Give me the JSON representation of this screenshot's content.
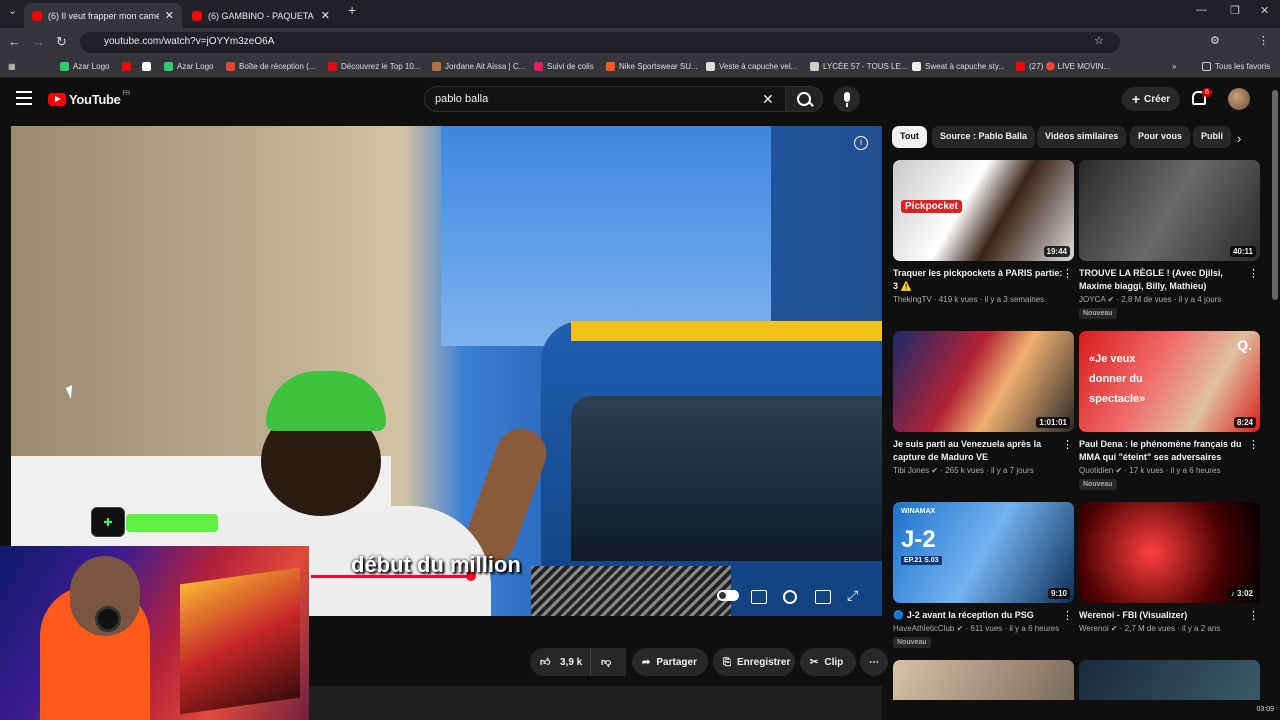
{
  "browser": {
    "tabs": [
      {
        "label": "(6) Il veut frapper mon caméra",
        "active": true
      },
      {
        "label": "(6) GAMBINO - PAQUETA (Clip",
        "active": false
      }
    ],
    "new_tab": "+",
    "url": "youtube.com/watch?v=jOYYm3zeO6A",
    "bookmarks": [
      "Azar Logo",
      "Azar Logo",
      "Boîte de réception (...",
      "Découvrez le Top 10...",
      "Jordane Ait Aissa | C...",
      "Suivi de colis",
      "Nike Sportswear SU...",
      "Veste à capuche vel...",
      "LYCÉE 57 - TOUS LE...",
      "Sweat à capuche sty...",
      "(27) 🔴 LIVE MOVIN..."
    ],
    "all_favorites": "Tous les favoris"
  },
  "youtube": {
    "logo": "YouTube",
    "region": "FR",
    "search_value": "pablo balla",
    "create_label": "Créer",
    "notification_count": "6"
  },
  "player": {
    "subtitle": "début du million",
    "info": "i"
  },
  "actions": {
    "like_count": "3,9 k",
    "share": "Partager",
    "save": "Enregistrer",
    "clip": "Clip",
    "more": "⋯"
  },
  "chips": [
    "Tout",
    "Source : Pablo Balla",
    "Vidéos similaires",
    "Pour vous",
    "Publi"
  ],
  "recommendations": [
    {
      "title": "Traquer les pickpockets à PARIS partie: 3 ⚠️",
      "channel": "ThekingTV",
      "meta": "419 k vues · il y a 3 semaines",
      "duration": "19:44",
      "badge": "",
      "thumb_text": "Pickpocket"
    },
    {
      "title": "TROUVE LA RÈGLE ! (Avec Djilsi, Maxime biaggi, Billy, Mathieu)",
      "channel": "JOYCA ✔",
      "meta": "2,8 M de vues · il y a 4 jours",
      "duration": "40:11",
      "badge": "Nouveau",
      "thumb_text": ""
    },
    {
      "title": "Je suis parti au Venezuela après la capture de Maduro VE",
      "channel": "Tibi Jones ✔",
      "meta": "265 k vues · il y a 7 jours",
      "duration": "1:01:01",
      "badge": "",
      "thumb_text": ""
    },
    {
      "title": "Paul Dena : le phénomène français du MMA qui \"éteint\" ses adversaires",
      "channel": "Quotidien ✔",
      "meta": "17 k vues · il y a 6 heures",
      "duration": "8:24",
      "badge": "Nouveau",
      "thumb_text": "«Je veux donner du spectacle»"
    },
    {
      "title": "🔵 J-2 avant la réception du PSG",
      "channel": "HaveAthleticClub ✔",
      "meta": "611 vues · il y a 6 heures",
      "duration": "9:10",
      "badge": "Nouveau",
      "thumb_text": "J-2"
    },
    {
      "title": "Werenoi - FBI (Visualizer)",
      "channel": "Werenoi ✔",
      "meta": "2,7 M de vues · il y a 2 ans",
      "duration": "♪ 3:02",
      "badge": "",
      "thumb_text": ""
    }
  ],
  "thumb_extra": {
    "winamax": "WINAMAX",
    "episode": "EP.21 S.03",
    "q": "Q."
  },
  "taskbar": {
    "time": "03:09"
  },
  "colors": {
    "accent": "#ff0000",
    "chip_active": "#f1f1f1",
    "bg": "#0f0f0f"
  }
}
